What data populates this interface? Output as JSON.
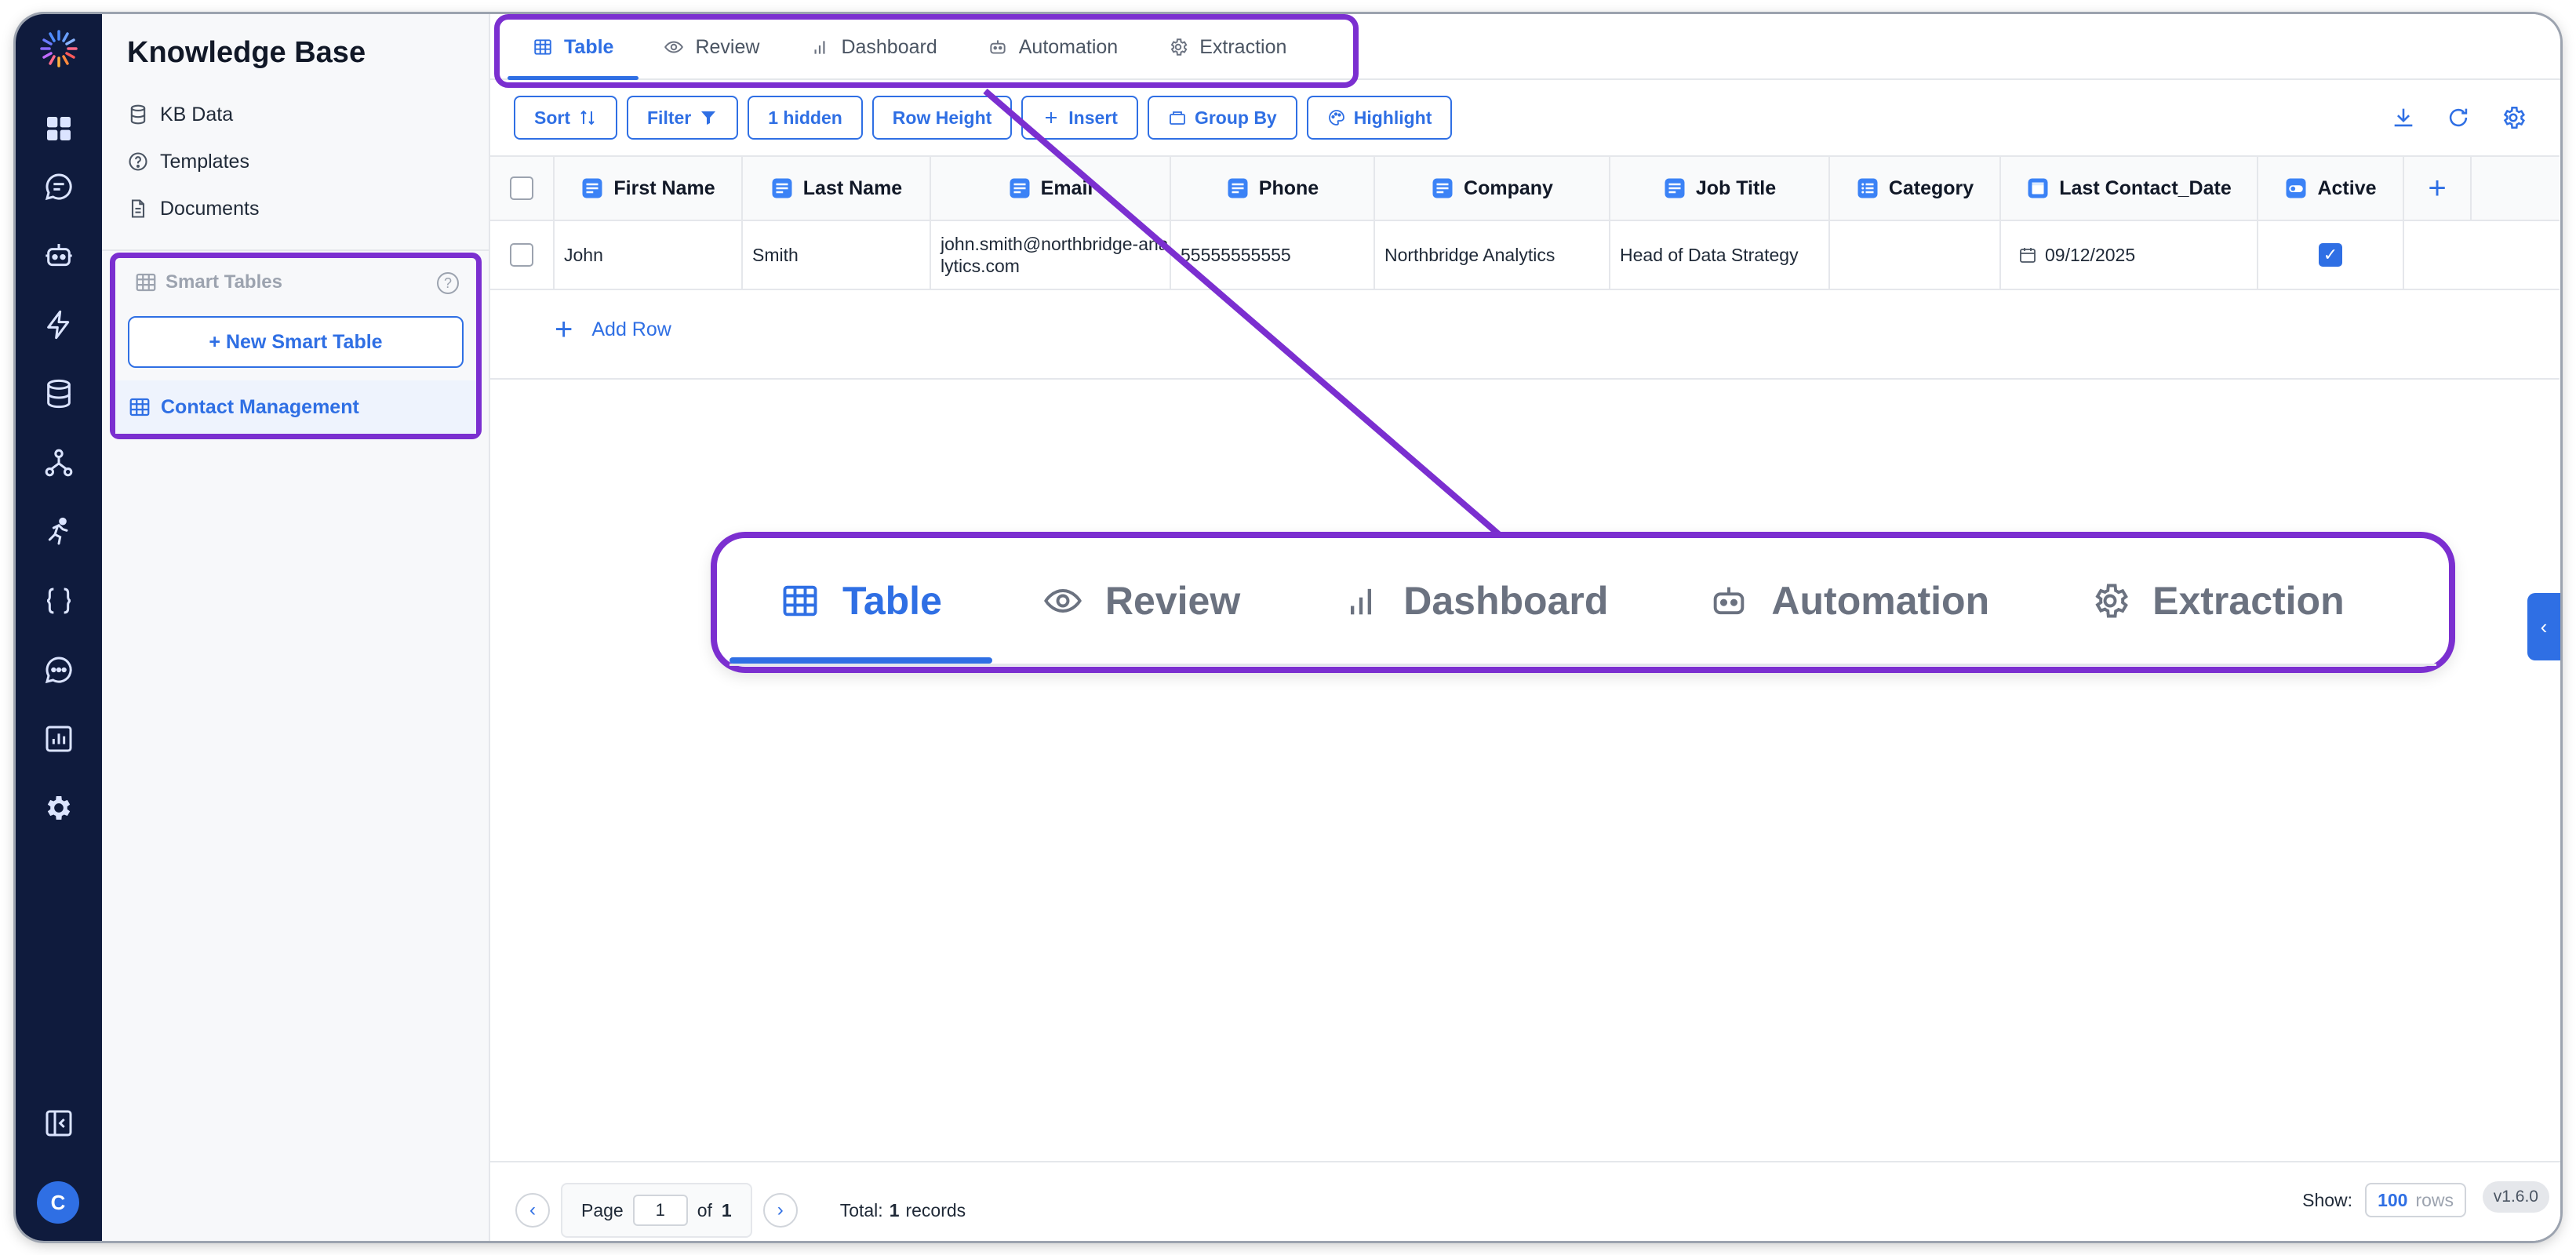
{
  "sidebar": {
    "title": "Knowledge Base",
    "items": [
      {
        "label": "KB Data",
        "icon": "database-icon"
      },
      {
        "label": "Templates",
        "icon": "question-circle-icon"
      },
      {
        "label": "Documents",
        "icon": "document-icon"
      }
    ],
    "smart_tables": {
      "heading": "Smart Tables",
      "help": "?",
      "new_button": "+ New Smart Table",
      "tables": [
        {
          "label": "Contact Management",
          "icon": "table-icon"
        }
      ]
    }
  },
  "rail": {
    "icons": [
      "dashboard-icon",
      "chat-icon",
      "bot-icon",
      "lightning-icon",
      "database-icon",
      "hierarchy-icon",
      "runner-icon",
      "braces-icon",
      "message-icon",
      "report-icon",
      "gear-icon"
    ],
    "collapse_icon": "collapse-sidebar-icon",
    "avatar_letter": "C"
  },
  "tabs": [
    {
      "label": "Table",
      "icon": "table-icon",
      "active": true
    },
    {
      "label": "Review",
      "icon": "eye-icon"
    },
    {
      "label": "Dashboard",
      "icon": "bar-chart-icon"
    },
    {
      "label": "Automation",
      "icon": "bot-icon"
    },
    {
      "label": "Extraction",
      "icon": "gear-icon"
    }
  ],
  "toolbar": {
    "sort": "Sort",
    "filter": "Filter",
    "hidden": "1 hidden",
    "row_height": "Row Height",
    "insert": "Insert",
    "group_by": "Group By",
    "highlight": "Highlight",
    "right_icons": [
      "download-icon",
      "refresh-icon",
      "settings-icon"
    ]
  },
  "table": {
    "columns": [
      "First Name",
      "Last Name",
      "Email",
      "Phone",
      "Company",
      "Job Title",
      "Category",
      "Last Contact_Date",
      "Active"
    ],
    "rows": [
      {
        "first_name": "John",
        "last_name": "Smith",
        "email": "john.smith@northbridge-analytics.com",
        "phone": "55555555555",
        "company": "Northbridge Analytics",
        "job_title": "Head of Data Strategy",
        "category": "",
        "last_contact_date": "09/12/2025",
        "active": true
      }
    ],
    "add_row": "Add Row",
    "add_column": "+"
  },
  "footer": {
    "page_label": "Page",
    "page_value": "1",
    "of_label": "of",
    "page_count": "1",
    "total_label": "Total:",
    "total_value": "1",
    "records_label": "records",
    "show_label": "Show:",
    "show_value": "100",
    "show_unit": "rows"
  },
  "version": "v1.6.0",
  "colors": {
    "accent": "#2f6fe4",
    "highlight": "#7b2fd0",
    "rail": "#0f1b3d"
  }
}
